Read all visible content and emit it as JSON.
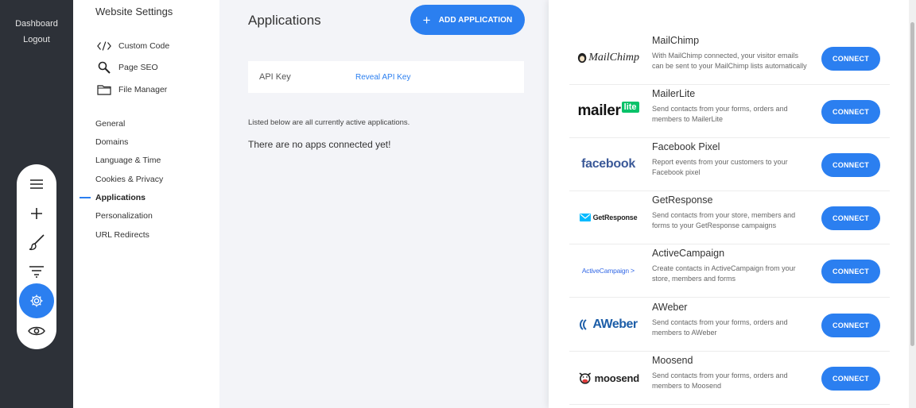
{
  "rail": {
    "dashboard": "Dashboard",
    "logout": "Logout"
  },
  "tools": [
    {
      "icon": "menu-icon"
    },
    {
      "icon": "plus-icon"
    },
    {
      "icon": "brush-icon"
    },
    {
      "icon": "filter-icon"
    },
    {
      "icon": "gear-icon",
      "active": true
    },
    {
      "icon": "eye-icon"
    }
  ],
  "settings": {
    "title": "Website Settings",
    "tools": [
      {
        "label": "Custom Code",
        "icon": "code-icon"
      },
      {
        "label": "Page SEO",
        "icon": "search-icon"
      },
      {
        "label": "File Manager",
        "icon": "folder-icon"
      }
    ],
    "nav": [
      "General",
      "Domains",
      "Language & Time",
      "Cookies & Privacy",
      "Applications",
      "Personalization",
      "URL Redirects"
    ],
    "active_nav": "Applications"
  },
  "main": {
    "title": "Applications",
    "add_button": "ADD APPLICATION",
    "api_key_label": "API Key",
    "api_key_link": "Reveal API Key",
    "list_note": "Listed below are all currently active applications.",
    "empty_note": "There are no apps connected yet!"
  },
  "modal": {
    "connect_label": "CONNECT",
    "apps": [
      {
        "name": "MailChimp",
        "desc": "With MailChimp connected, your visitor emails can be sent to your MailChimp lists automatically",
        "logo": "MailChimp"
      },
      {
        "name": "MailerLite",
        "desc": "Send contacts from your forms, orders and members to MailerLite",
        "logo": "mailer",
        "logo_badge": "lite"
      },
      {
        "name": "Facebook Pixel",
        "desc": "Report events from your customers to your Facebook pixel",
        "logo": "facebook"
      },
      {
        "name": "GetResponse",
        "desc": "Send contacts from your store, members and forms to your GetResponse campaigns",
        "logo": "GetResponse"
      },
      {
        "name": "ActiveCampaign",
        "desc": "Create contacts in ActiveCampaign from your store, members and forms",
        "logo": "ActiveCampaign"
      },
      {
        "name": "AWeber",
        "desc": "Send contacts from your forms, orders and members to AWeber",
        "logo": "AWeber"
      },
      {
        "name": "Moosend",
        "desc": "Send contacts from your forms, orders and members to Moosend",
        "logo": "moosend"
      }
    ]
  },
  "colors": {
    "accent": "#2b7ff0",
    "rail": "#2d3138",
    "mailerlite_green": "#09c269",
    "facebook_blue": "#3b5998",
    "aweber_blue": "#1d5ea8"
  }
}
